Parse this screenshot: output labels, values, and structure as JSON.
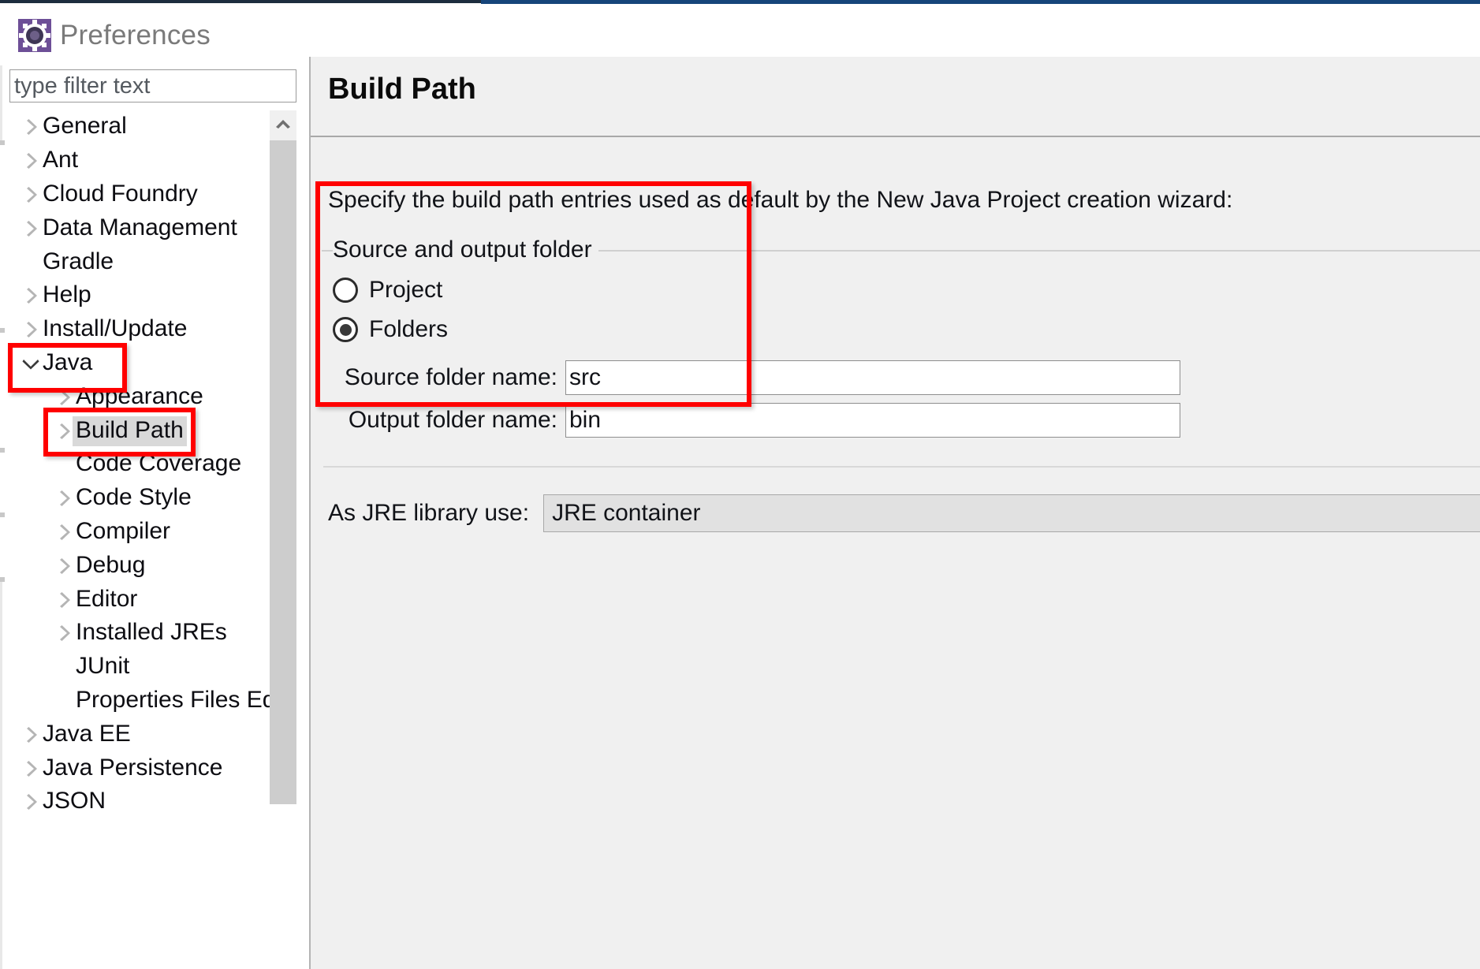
{
  "window": {
    "title": "Preferences",
    "icon": "gear-icon"
  },
  "sidebar": {
    "filter": {
      "placeholder": "type filter text",
      "value": ""
    },
    "scroll": {
      "up_arrow": "chevron-up-icon"
    },
    "items": [
      {
        "label": "General",
        "level": 0,
        "arrow": "collapsed",
        "selected": false
      },
      {
        "label": "Ant",
        "level": 0,
        "arrow": "collapsed",
        "selected": false
      },
      {
        "label": "Cloud Foundry",
        "level": 0,
        "arrow": "collapsed",
        "selected": false
      },
      {
        "label": "Data Management",
        "level": 0,
        "arrow": "collapsed",
        "selected": false
      },
      {
        "label": "Gradle",
        "level": 0,
        "arrow": "none",
        "selected": false
      },
      {
        "label": "Help",
        "level": 0,
        "arrow": "collapsed",
        "selected": false
      },
      {
        "label": "Install/Update",
        "level": 0,
        "arrow": "collapsed",
        "selected": false
      },
      {
        "label": "Java",
        "level": 0,
        "arrow": "expanded",
        "selected": false
      },
      {
        "label": "Appearance",
        "level": 1,
        "arrow": "collapsed",
        "selected": false
      },
      {
        "label": "Build Path",
        "level": 1,
        "arrow": "collapsed",
        "selected": true
      },
      {
        "label": "Code Coverage",
        "level": 1,
        "arrow": "none",
        "selected": false
      },
      {
        "label": "Code Style",
        "level": 1,
        "arrow": "collapsed",
        "selected": false
      },
      {
        "label": "Compiler",
        "level": 1,
        "arrow": "collapsed",
        "selected": false
      },
      {
        "label": "Debug",
        "level": 1,
        "arrow": "collapsed",
        "selected": false
      },
      {
        "label": "Editor",
        "level": 1,
        "arrow": "collapsed",
        "selected": false
      },
      {
        "label": "Installed JREs",
        "level": 1,
        "arrow": "collapsed",
        "selected": false
      },
      {
        "label": "JUnit",
        "level": 1,
        "arrow": "none",
        "selected": false
      },
      {
        "label": "Properties Files Ed",
        "level": 1,
        "arrow": "none",
        "selected": false
      },
      {
        "label": "Java EE",
        "level": 0,
        "arrow": "collapsed",
        "selected": false
      },
      {
        "label": "Java Persistence",
        "level": 0,
        "arrow": "collapsed",
        "selected": false
      },
      {
        "label": "JSON",
        "level": 0,
        "arrow": "collapsed",
        "selected": false
      }
    ]
  },
  "page": {
    "title": "Build Path",
    "description": "Specify the build path entries used as default by the New Java Project creation wizard:",
    "group": {
      "legend": "Source and output folder",
      "radios": [
        {
          "label": "Project",
          "selected": false
        },
        {
          "label": "Folders",
          "selected": true
        }
      ],
      "fields": [
        {
          "label": "Source folder name:",
          "value": "src"
        },
        {
          "label": "Output folder name:",
          "value": "bin"
        }
      ]
    },
    "jre": {
      "label": "As JRE library use:",
      "value": "JRE container"
    }
  },
  "annotations": {
    "color": "#ff0000",
    "boxes": [
      "java-tree-item",
      "build-path-tree-item",
      "source-and-output-folder-group"
    ]
  }
}
